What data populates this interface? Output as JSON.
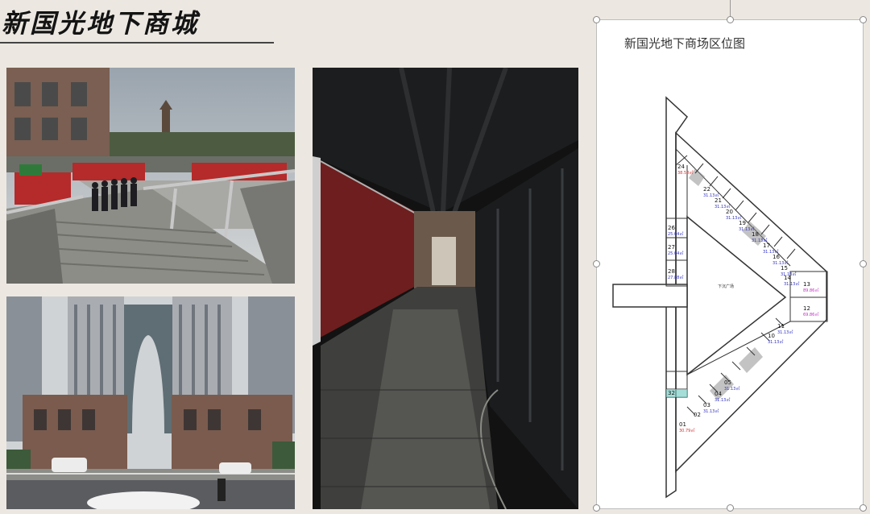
{
  "page": {
    "title": "新国光地下商城"
  },
  "photos": [
    {
      "name": "stairs-entrance-photo"
    },
    {
      "name": "arch-towers-photo"
    },
    {
      "name": "underground-corridor-photo"
    }
  ],
  "map": {
    "title": "新国光地下商场区位图",
    "center_label": "下沉广场",
    "units": [
      {
        "no": "24",
        "area": "38.58㎡",
        "area_color": "#d03030"
      },
      {
        "no": "22",
        "area": "31.13㎡",
        "area_color": "#3030c0"
      },
      {
        "no": "21",
        "area": "31.13㎡",
        "area_color": "#3030c0"
      },
      {
        "no": "20",
        "area": "31.13㎡",
        "area_color": "#3030c0"
      },
      {
        "no": "19",
        "area": "31.13㎡",
        "area_color": "#3030c0"
      },
      {
        "no": "18",
        "area": "31.13㎡",
        "area_color": "#3030c0"
      },
      {
        "no": "17",
        "area": "31.13㎡",
        "area_color": "#3030c0"
      },
      {
        "no": "16",
        "area": "31.13㎡",
        "area_color": "#3030c0"
      },
      {
        "no": "15",
        "area": "31.13㎡",
        "area_color": "#3030c0"
      },
      {
        "no": "14",
        "area": "31.13㎡",
        "area_color": "#3030c0"
      },
      {
        "no": "13",
        "area": "89.86㎡",
        "area_color": "#c030c0"
      },
      {
        "no": "12",
        "area": "69.86㎡",
        "area_color": "#c030c0"
      },
      {
        "no": "11",
        "area": "31.13㎡",
        "area_color": "#3030c0"
      },
      {
        "no": "10",
        "area": "31.13㎡",
        "area_color": "#3030c0"
      },
      {
        "no": "05",
        "area": "31.13㎡",
        "area_color": "#3030c0"
      },
      {
        "no": "04",
        "area": "31.13㎡",
        "area_color": "#3030c0"
      },
      {
        "no": "03",
        "area": "31.13㎡",
        "area_color": "#3030c0"
      },
      {
        "no": "02",
        "area": "",
        "area_color": "#3030c0"
      },
      {
        "no": "01",
        "area": "30.79㎡",
        "area_color": "#d03030"
      },
      {
        "no": "26",
        "area": "25.04㎡",
        "area_color": "#3030c0"
      },
      {
        "no": "27",
        "area": "25.04㎡",
        "area_color": "#3030c0"
      },
      {
        "no": "28",
        "area": "27.88㎡",
        "area_color": "#3030c0"
      },
      {
        "no": "32",
        "area": "",
        "area_color": "#3030c0"
      }
    ]
  }
}
